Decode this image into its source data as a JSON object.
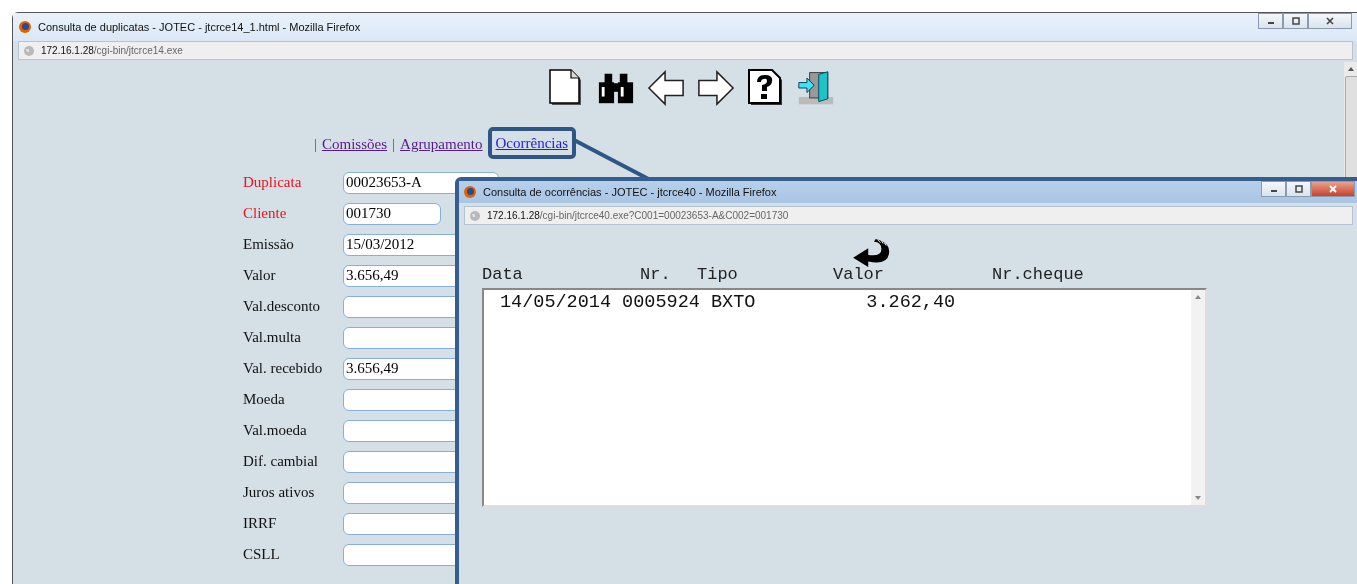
{
  "window": {
    "title": "Consulta de duplicatas - JOTEC - jtcrce14_1.html - Mozilla Firefox",
    "address_host": "172.16.1.28",
    "address_path": "/cgi-bin/jtcrce14.exe"
  },
  "links": [
    {
      "kind": "sep",
      "text": "|"
    },
    {
      "kind": "link",
      "text": "Comissões",
      "visited": true
    },
    {
      "kind": "sep",
      "text": "|"
    },
    {
      "kind": "link",
      "text": "Agrupamento",
      "visited": true
    },
    {
      "kind": "link",
      "text": "Ocorrências",
      "visited": false,
      "highlighted": true
    }
  ],
  "fields": [
    {
      "label": "Duplicata",
      "value": "00023653-A",
      "required": true,
      "kind": "long"
    },
    {
      "label": "Cliente",
      "value": "001730",
      "required": true,
      "kind": "short"
    },
    {
      "label": "Emissão",
      "value": "15/03/2012",
      "required": false,
      "kind": "long"
    },
    {
      "label": "Valor",
      "value": "3.656,49",
      "required": false,
      "kind": "long"
    },
    {
      "label": "Val.desconto",
      "required": false,
      "kind": "long"
    },
    {
      "label": "Val.multa",
      "required": false,
      "kind": "long"
    },
    {
      "label": "Val. recebido",
      "value": "3.656,49",
      "required": false,
      "kind": "long"
    },
    {
      "label": "Moeda",
      "required": false,
      "kind": "long"
    },
    {
      "label": "Val.moeda",
      "required": false,
      "kind": "long"
    },
    {
      "label": "Dif. cambial",
      "required": false,
      "kind": "long"
    },
    {
      "label": "Juros ativos",
      "required": false,
      "kind": "long"
    },
    {
      "label": "IRRF",
      "required": false,
      "kind": "long"
    },
    {
      "label": "CSLL",
      "required": false,
      "kind": "long"
    }
  ],
  "popup": {
    "title": "Consulta de ocorrências - JOTEC - jtcrce40 - Mozilla Firefox",
    "address_host": "172.16.1.28",
    "address_path": "/cgi-bin/jtcrce40.exe?C001=00023653-A&C002=001730",
    "columns": [
      "Data",
      "Nr.",
      "Tipo",
      "Valor",
      "Nr.cheque"
    ],
    "rows": [
      "14/05/2014 0005924 BXTO          3.262,40"
    ]
  }
}
